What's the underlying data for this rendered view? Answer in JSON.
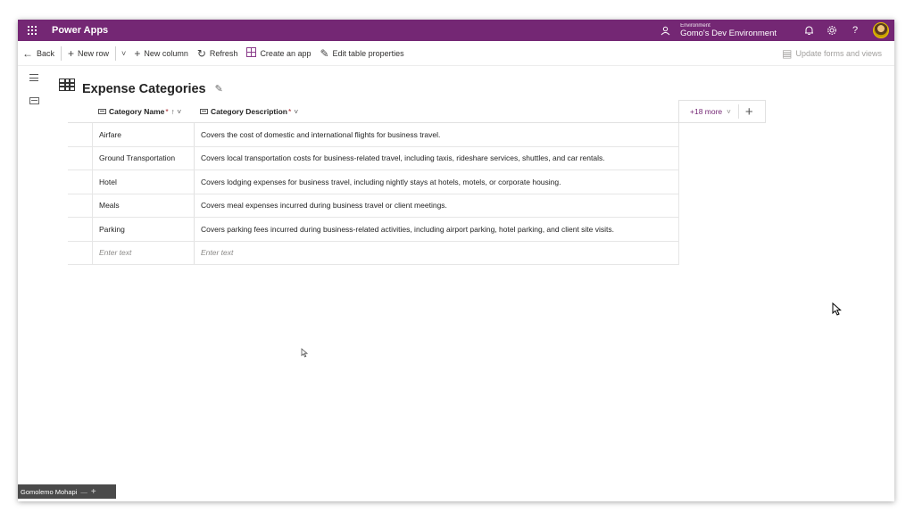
{
  "header": {
    "app_name": "Power Apps",
    "environment_label": "Environment",
    "environment_name": "Gomo's Dev Environment",
    "brand_color": "#742774"
  },
  "toolbar": {
    "back": "Back",
    "new_row": "New row",
    "new_column": "New column",
    "refresh": "Refresh",
    "create_app": "Create an app",
    "edit_table": "Edit table properties",
    "update_forms": "Update forms and views"
  },
  "page": {
    "title": "Expense Categories"
  },
  "grid": {
    "columns": [
      {
        "label": "Category Name",
        "required": "*",
        "sort": "↑ ˅"
      },
      {
        "label": "Category Description",
        "required": "*",
        "sort": "˅"
      }
    ],
    "rows": [
      {
        "name": "Airfare",
        "description": "Covers the cost of domestic and international flights for business travel."
      },
      {
        "name": "Ground Transportation",
        "description": "Covers local transportation costs for business-related travel, including taxis, rideshare services, shuttles, and car rentals."
      },
      {
        "name": "Hotel",
        "description": "Covers lodging expenses for business travel, including nightly stays at hotels, motels, or corporate housing."
      },
      {
        "name": "Meals",
        "description": "Covers meal expenses incurred during business travel or client meetings."
      },
      {
        "name": "Parking",
        "description": "Covers parking fees incurred during business-related activities, including airport parking, hotel parking, and client site visits."
      }
    ],
    "new_row_placeholder_name": "Enter text",
    "new_row_placeholder_desc": "Enter text",
    "more_columns": "+18 more"
  },
  "footer": {
    "presenter": "Gomolemo Mohapi"
  }
}
